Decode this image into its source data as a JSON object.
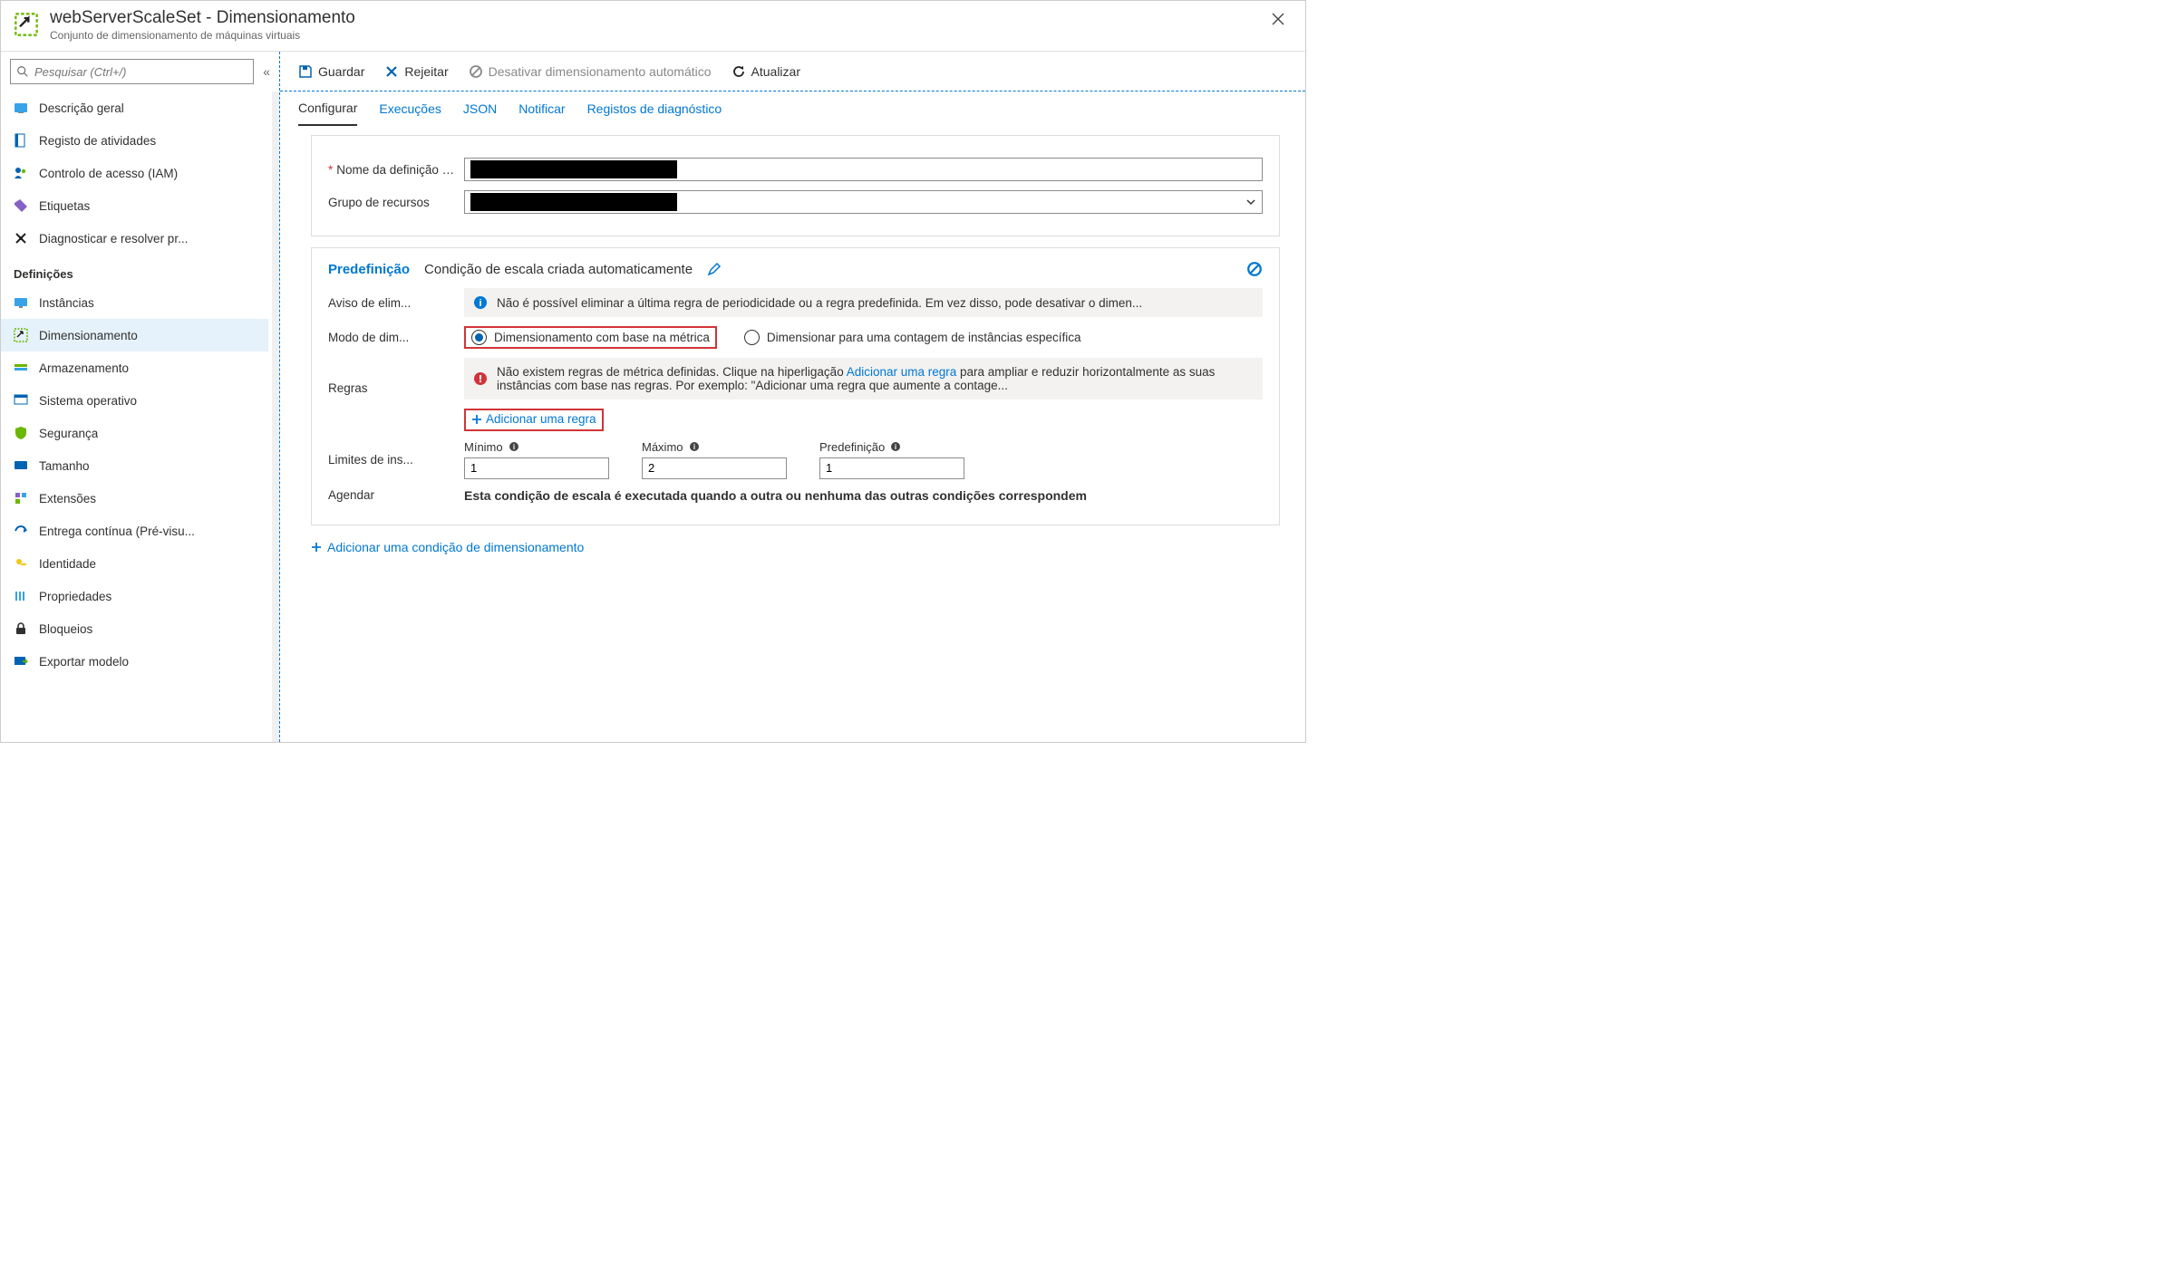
{
  "header": {
    "title": "webServerScaleSet - Dimensionamento",
    "subtitle": "Conjunto de dimensionamento de máquinas virtuais"
  },
  "search": {
    "placeholder": "Pesquisar (Ctrl+/)"
  },
  "sidebar": {
    "items_top": [
      {
        "label": "Descrição geral",
        "icon": "overview"
      },
      {
        "label": "Registo de atividades",
        "icon": "activity"
      },
      {
        "label": "Controlo de acesso (IAM)",
        "icon": "iam"
      },
      {
        "label": "Etiquetas",
        "icon": "tags"
      },
      {
        "label": "Diagnosticar e resolver pr...",
        "icon": "diagnose"
      }
    ],
    "section_title": "Definições",
    "items_bottom": [
      {
        "label": "Instâncias",
        "icon": "instances"
      },
      {
        "label": "Dimensionamento",
        "icon": "scaling",
        "active": true
      },
      {
        "label": "Armazenamento",
        "icon": "storage"
      },
      {
        "label": "Sistema operativo",
        "icon": "os"
      },
      {
        "label": "Segurança",
        "icon": "security"
      },
      {
        "label": "Tamanho",
        "icon": "size"
      },
      {
        "label": "Extensões",
        "icon": "ext"
      },
      {
        "label": "Entrega contínua (Pré-visu...",
        "icon": "cd"
      },
      {
        "label": "Identidade",
        "icon": "identity"
      },
      {
        "label": "Propriedades",
        "icon": "props"
      },
      {
        "label": "Bloqueios",
        "icon": "locks"
      },
      {
        "label": "Exportar modelo",
        "icon": "export"
      }
    ]
  },
  "cmdbar": {
    "save": "Guardar",
    "reject": "Rejeitar",
    "disable_auto": "Desativar dimensionamento automático",
    "refresh": "Atualizar"
  },
  "tabs": [
    {
      "label": "Configurar",
      "active": true
    },
    {
      "label": "Execuções"
    },
    {
      "label": "JSON"
    },
    {
      "label": "Notificar"
    },
    {
      "label": "Registos de diagnóstico"
    }
  ],
  "form": {
    "def_name_label": "Nome da definição de...",
    "rg_label": "Grupo de recursos"
  },
  "condition": {
    "predef": "Predefinição",
    "title": "Condição de escala criada automaticamente",
    "delete_warn_label": "Aviso de elim...",
    "delete_warn": "Não é possível eliminar a última regra de periodicidade ou a regra predefinida. Em vez disso, pode desativar o dimen...",
    "mode_label": "Modo de dim...",
    "mode_metric": "Dimensionamento com base na métrica",
    "mode_count": "Dimensionar para uma contagem de instâncias específica",
    "rules_label": "Regras",
    "rules_banner_pre": "Não existem regras de métrica definidas. Clique na hiperligação ",
    "rules_banner_link": "Adicionar uma regra",
    "rules_banner_post": " para ampliar e reduzir horizontalmente as suas instâncias com base nas regras. Por exemplo: \"Adicionar uma regra que aumente a contage...",
    "add_rule": "Adicionar uma regra",
    "limits_label": "Limites de ins...",
    "limits": {
      "min_label": "Mínimo",
      "min_val": "1",
      "max_label": "Máximo",
      "max_val": "2",
      "def_label": "Predefinição",
      "def_val": "1"
    },
    "sched_label": "Agendar",
    "sched_text": "Esta condição de escala é executada quando a outra ou nenhuma das outras condições correspondem"
  },
  "add_cond": "Adicionar uma condição de dimensionamento",
  "icon_colors": {
    "accent": "#0078d4",
    "green": "#6bb700",
    "red": "#d13438",
    "gray": "#666666"
  }
}
